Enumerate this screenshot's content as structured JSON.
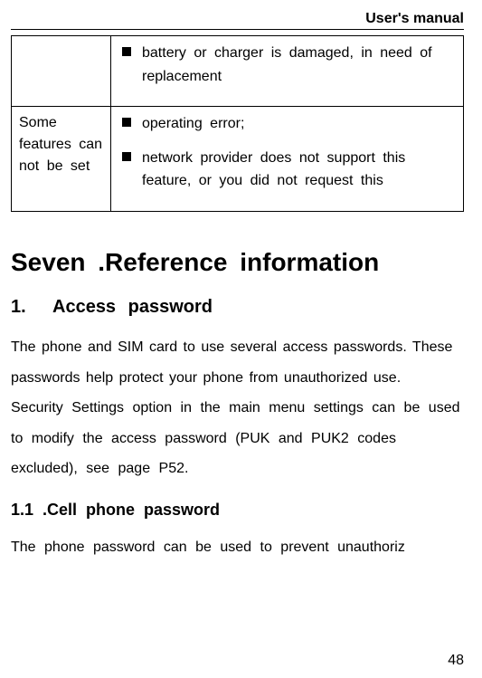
{
  "header": {
    "title": "User's manual"
  },
  "table": {
    "rows": [
      {
        "left": "",
        "items": [
          "battery or charger is damaged, in need of replacement"
        ]
      },
      {
        "left": "Some features can not be set",
        "items": [
          "operating error;",
          "network provider does not support this feature, or you did not request this"
        ]
      }
    ]
  },
  "section": {
    "title": "Seven .Reference information",
    "sub1": {
      "num": "1.",
      "title": "Access password",
      "para1": "The phone and SIM card to use several access passwords. These passwords help protect your phone from unauthorized use.",
      "para2": "Security Settings option in the main menu settings can be used to modify the access password (PUK and PUK2 codes excluded), see page P52."
    },
    "sub11": {
      "title": "1.1 .Cell phone password",
      "para": "The phone password can be used to prevent unauthoriz"
    }
  },
  "pageNumber": "48"
}
